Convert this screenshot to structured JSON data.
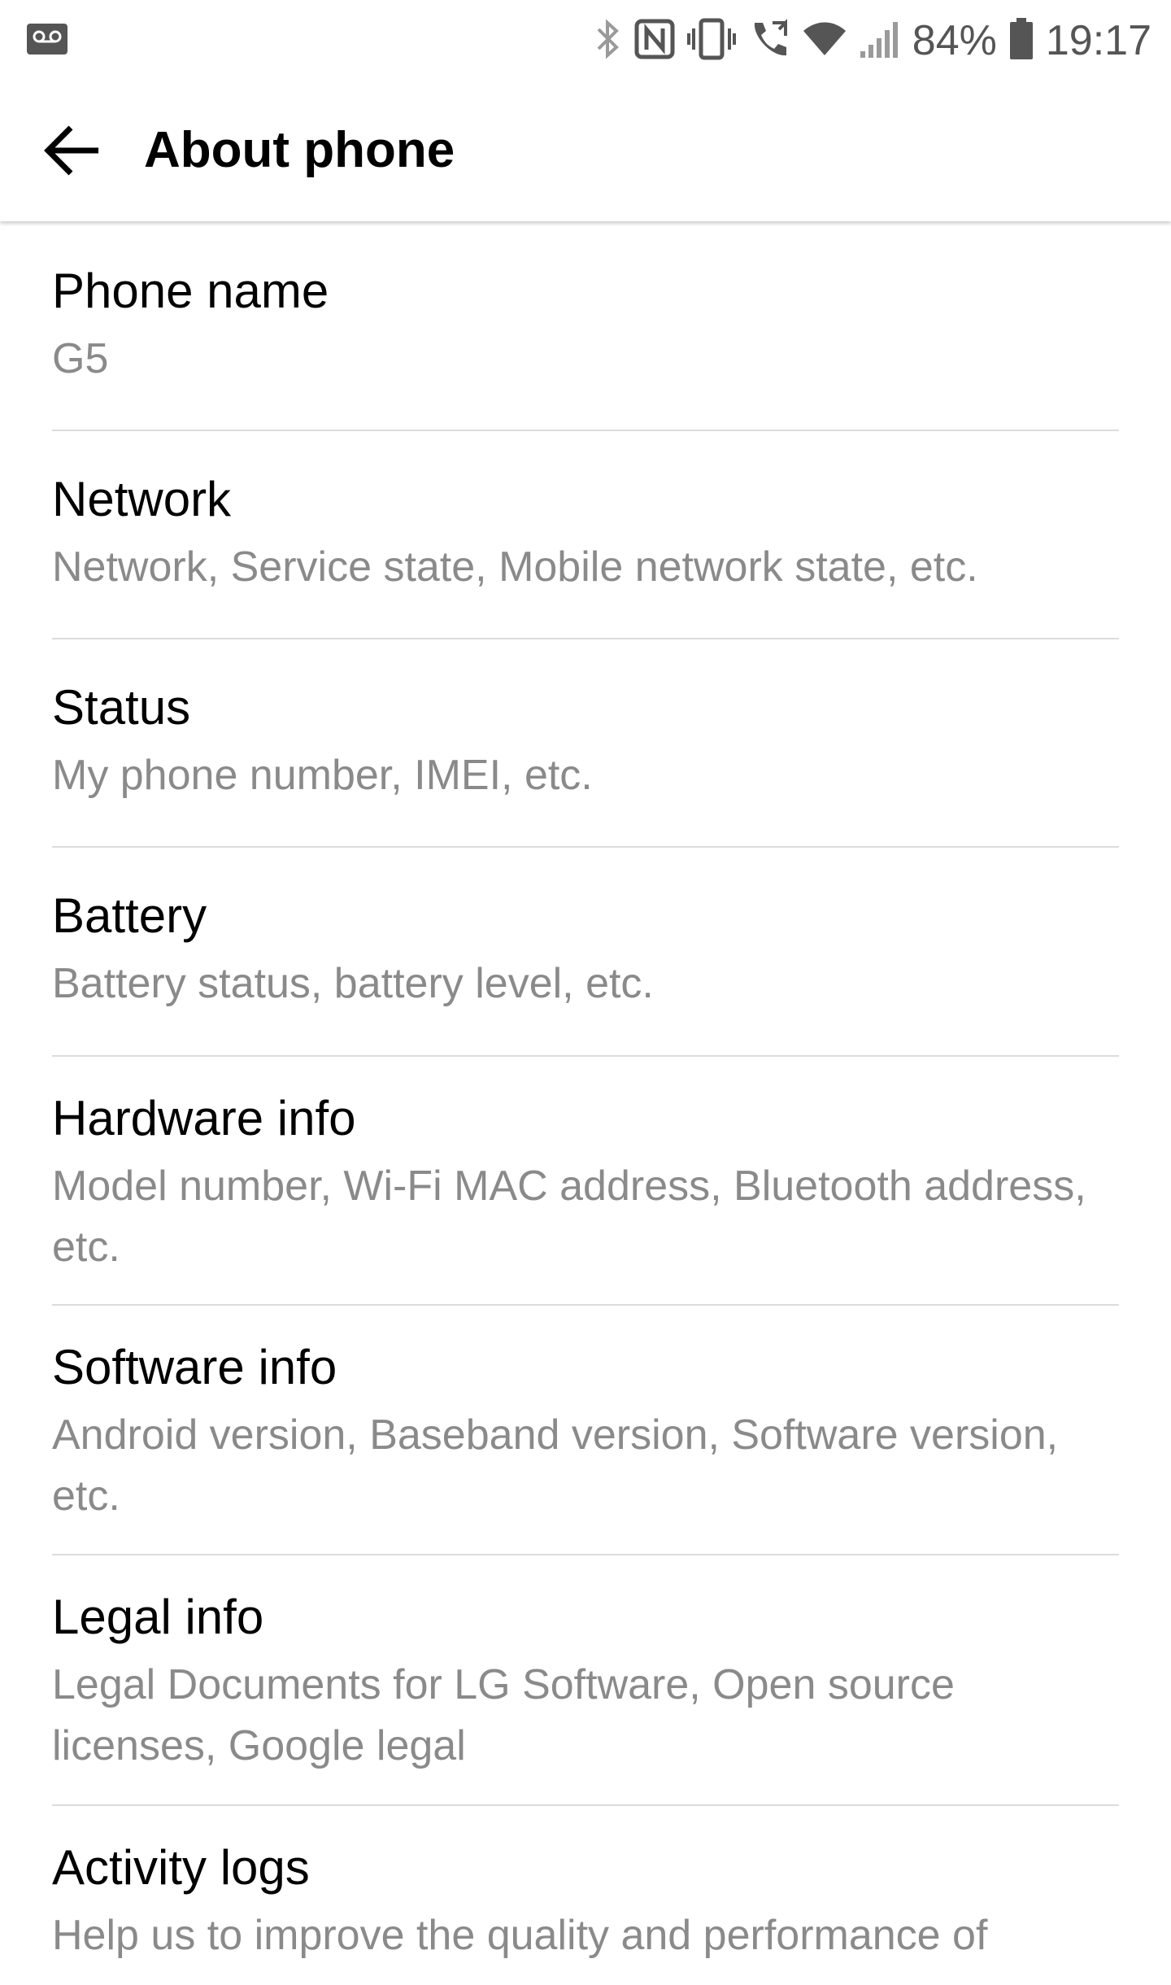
{
  "status_bar": {
    "battery_percent": "84%",
    "time": "19:17",
    "icons": [
      "voicemail-icon",
      "bluetooth-icon",
      "nfc-icon",
      "vibrate-icon",
      "wifi-calling-icon",
      "wifi-icon",
      "signal-icon",
      "battery-icon"
    ]
  },
  "app_bar": {
    "title": "About phone",
    "back_icon": "arrow-back-icon"
  },
  "items": [
    {
      "title": "Phone name",
      "summary": "G5"
    },
    {
      "title": "Network",
      "summary": "Network, Service state, Mobile network state, etc."
    },
    {
      "title": "Status",
      "summary": "My phone number, IMEI, etc."
    },
    {
      "title": "Battery",
      "summary": "Battery status, battery level, etc."
    },
    {
      "title": "Hardware info",
      "summary": "Model number, Wi-Fi MAC address, Bluetooth address, etc."
    },
    {
      "title": "Software info",
      "summary": "Android version, Baseband version, Software version, etc."
    },
    {
      "title": "Legal info",
      "summary": "Legal Documents for LG Software, Open source licenses, Google legal"
    },
    {
      "title": "Activity logs",
      "summary": "Help us to improve the quality and performance of"
    }
  ],
  "colors": {
    "title_text": "#000000",
    "summary_text": "#8a8a8a",
    "divider": "#dcdcdc",
    "status_icons": "#555555"
  }
}
